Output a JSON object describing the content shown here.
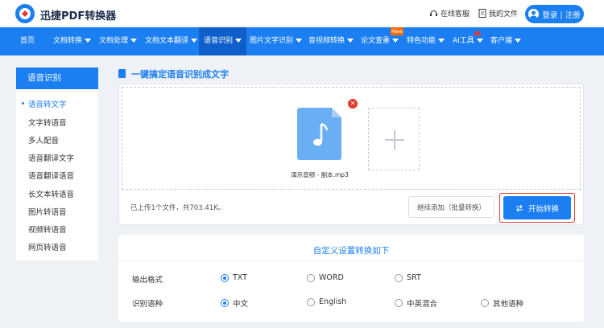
{
  "app": {
    "brand": "迅捷PDF转换器",
    "colors": {
      "primary": "#1b7ff2",
      "highlight": "#e8392f",
      "badge": "#ff6a00",
      "background": "#eef1f6"
    }
  },
  "topbar": {
    "service_label": "在线客服",
    "myfiles_label": "我的文件",
    "login_label": "登录 | 注册"
  },
  "nav": {
    "items": [
      {
        "label": "首页",
        "dropdown": false
      },
      {
        "label": "文档转换",
        "dropdown": true
      },
      {
        "label": "文档处理",
        "dropdown": true
      },
      {
        "label": "文档文本翻译",
        "dropdown": true
      },
      {
        "label": "语音识别",
        "dropdown": true,
        "active": true
      },
      {
        "label": "图片文字识别",
        "dropdown": true
      },
      {
        "label": "音视频转换",
        "dropdown": true
      },
      {
        "label": "论文查重",
        "dropdown": true
      },
      {
        "label": "特色功能",
        "dropdown": true
      },
      {
        "label": "AI工具",
        "dropdown": true
      },
      {
        "label": "客户端",
        "dropdown": true
      }
    ],
    "new_badge": "New"
  },
  "sidebar": {
    "title": "语音识别",
    "items": [
      {
        "label": "语音转文字",
        "active": true
      },
      {
        "label": "文字转语音"
      },
      {
        "label": "多人配音"
      },
      {
        "label": "语音翻译文字"
      },
      {
        "label": "语音翻译语音"
      },
      {
        "label": "长文本转语音"
      },
      {
        "label": "图片转语音"
      },
      {
        "label": "视频转语音"
      },
      {
        "label": "网页转语音"
      }
    ]
  },
  "main": {
    "section_title": "一键搞定语音识别成文字",
    "file": {
      "name": "演示音频 - 副本.mp3",
      "icon": "music-note-icon"
    },
    "upload_status": "已上传1个文件，共703.41K。",
    "continue_label": "继续添加（批量转换）",
    "start_label": "开始转换"
  },
  "settings": {
    "title": "自定义设置转换如下",
    "output": {
      "label": "输出格式",
      "options": [
        "TXT",
        "WORD",
        "SRT"
      ],
      "selected": "TXT"
    },
    "language": {
      "label": "识别语种",
      "options": [
        "中文",
        "English",
        "中英混合",
        "其他语种"
      ],
      "selected": "中文"
    }
  }
}
